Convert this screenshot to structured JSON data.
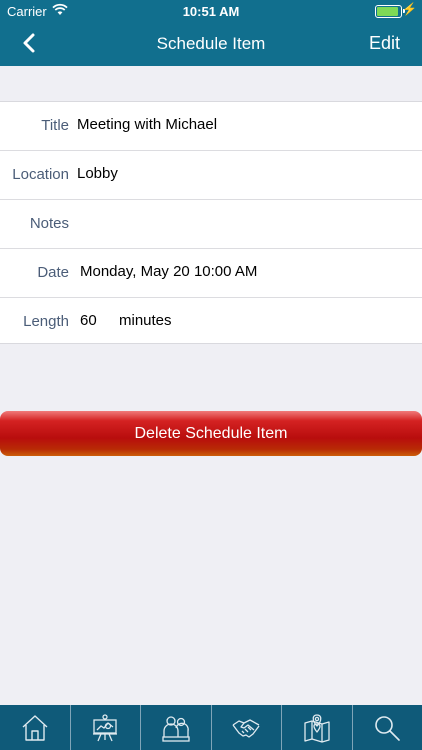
{
  "status_bar": {
    "carrier": "Carrier",
    "time": "10:51 AM",
    "battery_level": 0.9
  },
  "nav": {
    "title": "Schedule Item",
    "edit_label": "Edit"
  },
  "form": {
    "title_label": "Title",
    "title_value": "Meeting with Michael",
    "location_label": "Location",
    "location_value": "Lobby",
    "notes_label": "Notes",
    "notes_value": "",
    "date_label": "Date",
    "date_value": "Monday, May 20 10:00 AM",
    "length_label": "Length",
    "length_value": "60",
    "length_unit": "minutes"
  },
  "delete_button_label": "Delete Schedule Item",
  "tabbar": {
    "icons": [
      "home-icon",
      "presentation-icon",
      "people-icon",
      "handshake-icon",
      "map-icon",
      "search-icon"
    ]
  },
  "colors": {
    "header": "#116f8e",
    "tabbar": "#0f5a79",
    "label": "#4b5d78",
    "delete": "#b80d0d"
  }
}
